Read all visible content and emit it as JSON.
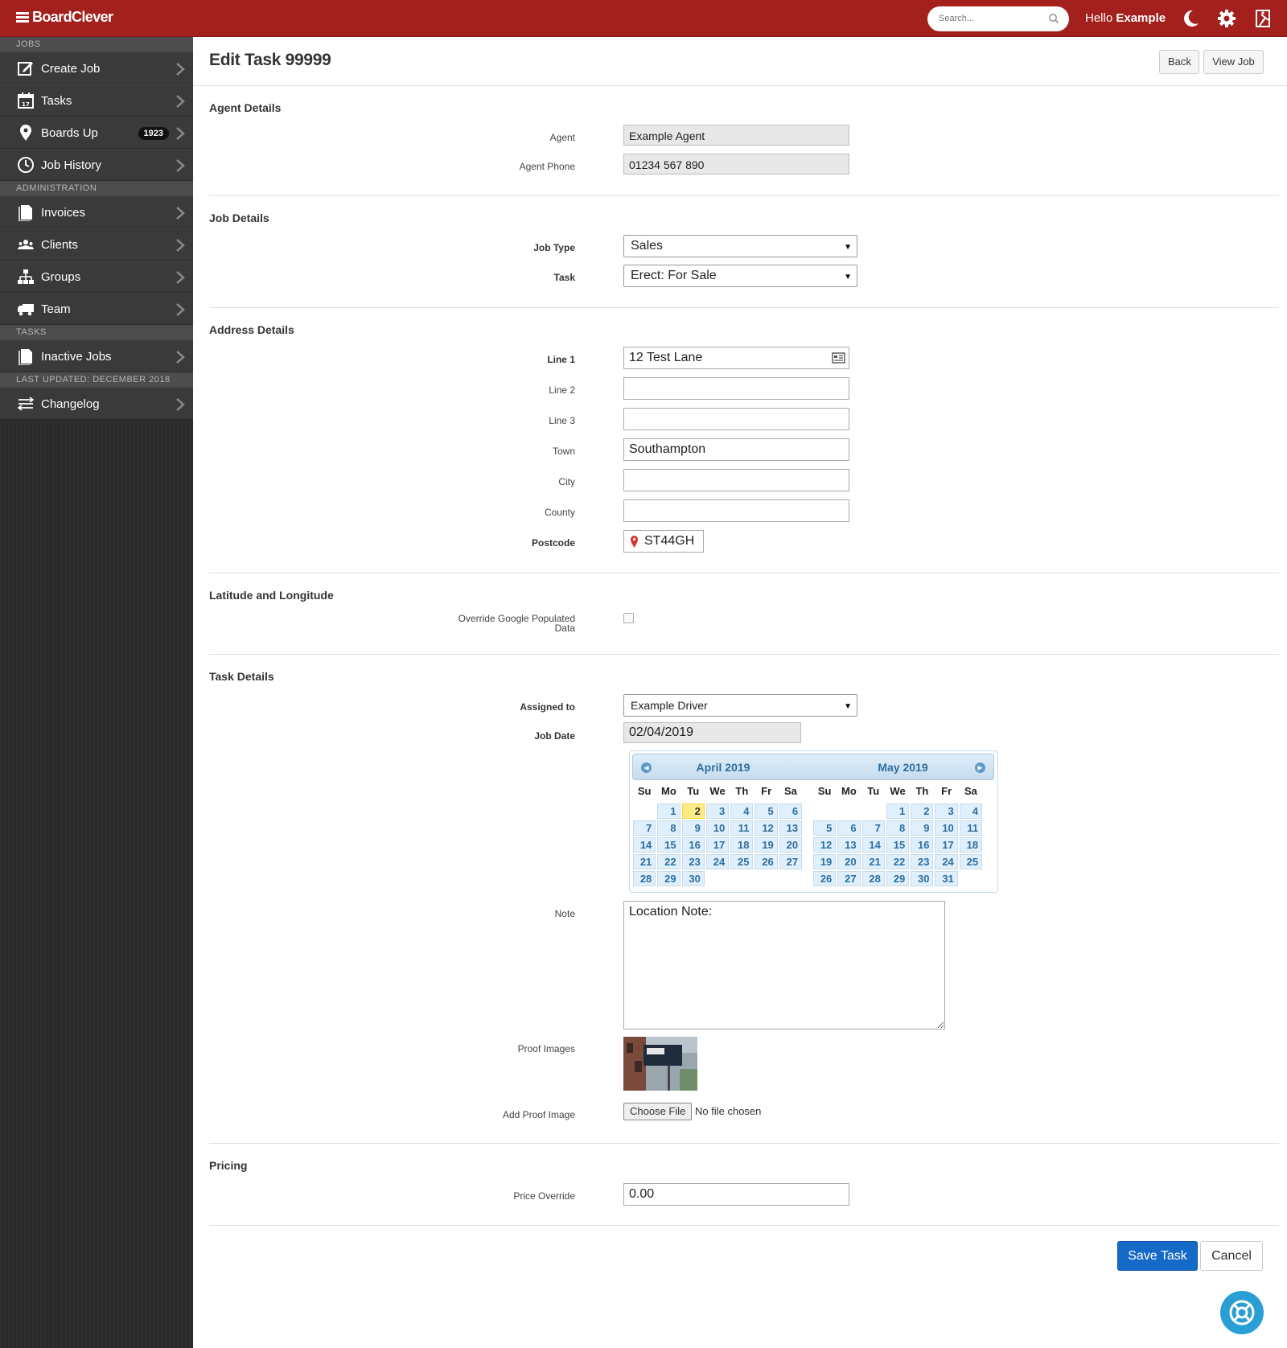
{
  "app": {
    "brand": "BoardClever"
  },
  "topbar": {
    "search_placeholder": "Search...",
    "greeting": "Hello",
    "user_name": "Example"
  },
  "sidebar": {
    "sections": {
      "jobs": "JOBS",
      "administration": "ADMINISTRATION",
      "tasks": "TASKS",
      "last_updated": "LAST UPDATED: DECEMBER 2018"
    },
    "items": {
      "create_job": "Create Job",
      "tasks": "Tasks",
      "boards_up": "Boards Up",
      "boards_up_count": "1923",
      "job_history": "Job History",
      "invoices": "Invoices",
      "clients": "Clients",
      "groups": "Groups",
      "team": "Team",
      "inactive_jobs": "Inactive Jobs",
      "changelog": "Changelog"
    },
    "icons": {
      "create_job": "edit-icon",
      "tasks": "calendar-icon",
      "boards_up": "map-pin-icon",
      "job_history": "clock-icon",
      "invoices": "document-icon",
      "clients": "users-icon",
      "groups": "sitemap-icon",
      "team": "truck-icon",
      "inactive_jobs": "document-icon",
      "changelog": "sliders-icon"
    }
  },
  "header": {
    "title": "Edit Task 99999",
    "back_label": "Back",
    "view_job_label": "View Job"
  },
  "agent_details": {
    "title": "Agent Details",
    "agent_label": "Agent",
    "agent_value": "Example Agent",
    "phone_label": "Agent Phone",
    "phone_value": "01234 567 890"
  },
  "job_details": {
    "title": "Job Details",
    "job_type_label": "Job Type",
    "job_type_value": "Sales",
    "task_label": "Task",
    "task_value": "Erect: For Sale"
  },
  "address_details": {
    "title": "Address Details",
    "line1_label": "Line 1",
    "line1_value": "12 Test Lane",
    "line2_label": "Line 2",
    "line2_value": "",
    "line3_label": "Line 3",
    "line3_value": "",
    "town_label": "Town",
    "town_value": "Southampton",
    "city_label": "City",
    "city_value": "",
    "county_label": "County",
    "county_value": "",
    "postcode_label": "Postcode",
    "postcode_value": "ST44GH"
  },
  "lat_lng": {
    "title": "Latitude and Longitude",
    "override_label_line1": "Override Google Populated",
    "override_label_line2": "Data",
    "override_checked": false
  },
  "task_details": {
    "title": "Task Details",
    "assigned_label": "Assigned to",
    "assigned_value": "Example Driver",
    "job_date_label": "Job Date",
    "job_date_value": "02/04/2019",
    "note_label": "Note",
    "note_value": "Location Note:",
    "proof_images_label": "Proof Images",
    "add_proof_label": "Add Proof Image",
    "choose_file_label": "Choose File",
    "no_file_text": "No file chosen"
  },
  "calendar": {
    "dow": [
      "Su",
      "Mo",
      "Tu",
      "We",
      "Th",
      "Fr",
      "Sa"
    ],
    "months": [
      {
        "title": "April 2019",
        "offset": 1,
        "days": 30,
        "today": 2
      },
      {
        "title": "May 2019",
        "offset": 3,
        "days": 31,
        "today": null
      }
    ]
  },
  "pricing": {
    "title": "Pricing",
    "price_override_label": "Price Override",
    "price_override_value": "0.00"
  },
  "actions": {
    "save_label": "Save Task",
    "cancel_label": "Cancel"
  },
  "colors": {
    "topbar": "#a3201c",
    "primary": "#1569c7",
    "help": "#2a9fd6",
    "calendar_today": "#fbec88"
  }
}
